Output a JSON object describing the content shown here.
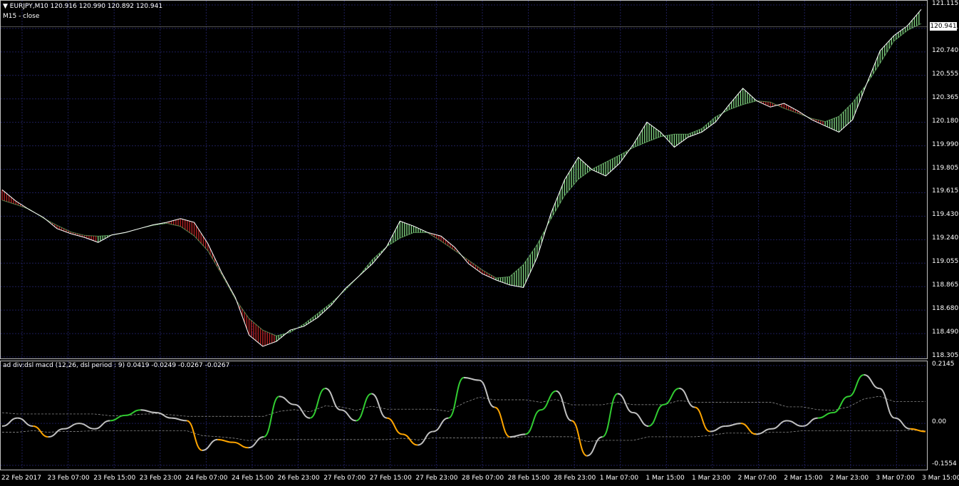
{
  "header": {
    "symbol_line": "EURJPY,M10  120.916 120.990 120.892 120.941",
    "sub_line": "M15 - close"
  },
  "indicator": {
    "title": "ad div:dsl macd (12,26, dsl period : 9) 0.0419 -0.0249 -0.0267 -0.0267"
  },
  "price_axis": {
    "labels": [
      "121.115",
      "120.941",
      "120.740",
      "120.555",
      "120.365",
      "120.180",
      "119.990",
      "119.805",
      "119.615",
      "119.430",
      "119.240",
      "119.055",
      "118.865",
      "118.680",
      "118.490",
      "118.305"
    ],
    "current": "120.941"
  },
  "indicator_axis": {
    "labels": [
      "0.2145",
      "0.00",
      "-0.1554"
    ]
  },
  "time_axis": {
    "labels": [
      "22 Feb 2017",
      "23 Feb 07:00",
      "23 Feb 15:00",
      "23 Feb 23:00",
      "24 Feb 07:00",
      "24 Feb 15:00",
      "26 Feb 23:00",
      "27 Feb 07:00",
      "27 Feb 15:00",
      "27 Feb 23:00",
      "28 Feb 07:00",
      "28 Feb 15:00",
      "28 Feb 23:00",
      "1 Mar 07:00",
      "1 Mar 15:00",
      "1 Mar 23:00",
      "2 Mar 07:00",
      "2 Mar 15:00",
      "2 Mar 23:00",
      "3 Mar 07:00",
      "3 Mar 15:00"
    ]
  },
  "colors": {
    "background": "#000000",
    "grid": "#1e1e5a",
    "price_line": "#ffffff",
    "up_band": "#7ccd7c",
    "down_band": "#b22222",
    "macd_up": "#32cd32",
    "macd_down": "#ffa500",
    "macd_neutral": "#c0c0c0"
  },
  "chart_data": {
    "type": "line",
    "title": "",
    "ylim": [
      118.305,
      121.115
    ],
    "series": [
      {
        "values": [
          119.64,
          119.55,
          119.48,
          119.42,
          119.33,
          119.29,
          119.26,
          119.22,
          119.28,
          119.3,
          119.33,
          119.36,
          119.38,
          119.41,
          119.38,
          119.21,
          118.98,
          118.78,
          118.48,
          118.39,
          118.43,
          118.52,
          118.55,
          118.62,
          118.72,
          118.85,
          118.95,
          119.05,
          119.18,
          119.39,
          119.35,
          119.3,
          119.27,
          119.18,
          119.05,
          118.97,
          118.92,
          118.88,
          118.86,
          119.1,
          119.45,
          119.72,
          119.9,
          119.8,
          119.75,
          119.85,
          120.0,
          120.18,
          120.1,
          119.98,
          120.06,
          120.1,
          120.18,
          120.32,
          120.45,
          120.35,
          120.3,
          120.33,
          120.27,
          120.2,
          120.15,
          120.1,
          120.2,
          120.48,
          120.75,
          120.87,
          120.95,
          121.08
        ]
      }
    ]
  },
  "indicator_data": {
    "type": "line",
    "ylim": [
      -0.1554,
      0.2145
    ],
    "values": [
      -0.01,
      0.02,
      -0.01,
      -0.05,
      -0.02,
      0.0,
      -0.02,
      0.01,
      0.03,
      0.05,
      0.04,
      0.02,
      0.01,
      -0.1,
      -0.06,
      -0.07,
      -0.09,
      -0.05,
      0.1,
      0.07,
      0.02,
      0.13,
      0.05,
      0.01,
      0.11,
      0.02,
      -0.04,
      -0.08,
      -0.03,
      0.02,
      0.17,
      0.16,
      0.06,
      -0.05,
      -0.04,
      0.05,
      0.12,
      0.01,
      -0.12,
      -0.05,
      0.11,
      0.04,
      -0.01,
      0.07,
      0.13,
      0.06,
      -0.03,
      -0.01,
      0.0,
      -0.04,
      -0.02,
      0.01,
      -0.01,
      0.02,
      0.04,
      0.1,
      0.18,
      0.13,
      0.02,
      -0.02,
      -0.03
    ]
  }
}
